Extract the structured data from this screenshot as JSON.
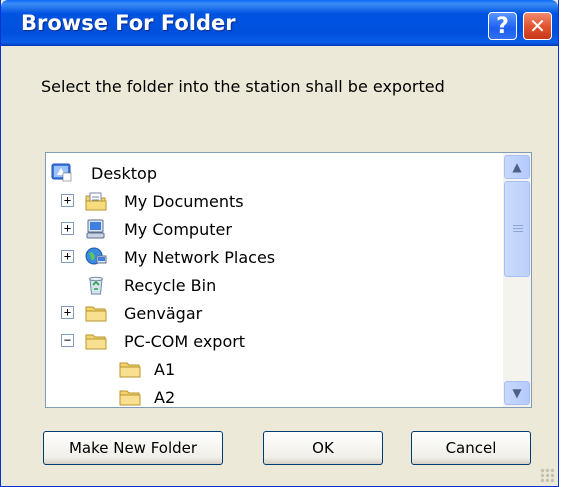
{
  "window": {
    "title": "Browse For Folder",
    "help_glyph": "?",
    "close_glyph": "✕"
  },
  "prompt": "Select the folder into the station shall be exported",
  "tree": {
    "items": [
      {
        "label": "Desktop",
        "icon": "desktop-icon",
        "expander": ""
      },
      {
        "label": "My Documents",
        "icon": "my-documents-icon",
        "expander": "+"
      },
      {
        "label": "My Computer",
        "icon": "my-computer-icon",
        "expander": "+"
      },
      {
        "label": "My Network Places",
        "icon": "network-places-icon",
        "expander": "+"
      },
      {
        "label": "Recycle Bin",
        "icon": "recycle-bin-icon",
        "expander": ""
      },
      {
        "label": "Genvägar",
        "icon": "folder-icon",
        "expander": "+"
      },
      {
        "label": "PC-COM export",
        "icon": "folder-icon",
        "expander": "−"
      },
      {
        "label": "A1",
        "icon": "folder-icon",
        "expander": ""
      },
      {
        "label": "A2",
        "icon": "folder-icon",
        "expander": ""
      }
    ]
  },
  "scrollbar": {
    "up_glyph": "▲",
    "down_glyph": "▼"
  },
  "buttons": {
    "make_new_folder": "Make New Folder",
    "ok": "OK",
    "cancel": "Cancel"
  },
  "colors": {
    "titlebar": "#0053e1",
    "dialog_bg": "#ece9d8",
    "tree_border": "#7f9db9",
    "folder": "#f3d36b"
  }
}
